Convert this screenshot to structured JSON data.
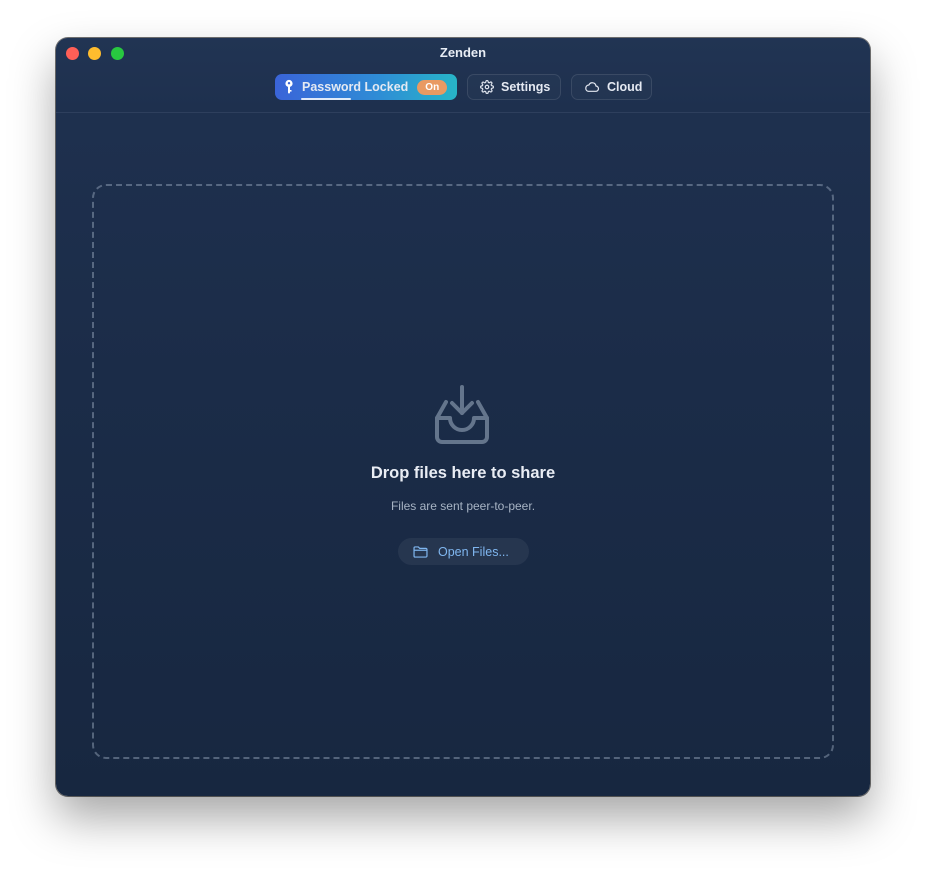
{
  "window": {
    "title": "Zenden"
  },
  "toolbar": {
    "password_label": "Password Locked",
    "password_badge": "On",
    "settings_label": "Settings",
    "cloud_label": "Cloud"
  },
  "dropzone": {
    "title": "Drop files here to share",
    "subtitle": "Files are sent peer-to-peer.",
    "open_button_label": "Open Files..."
  },
  "colors": {
    "window_bg": "#1b2c48",
    "accent_gradient_start": "#3a64d8",
    "accent_gradient_end": "#27b5c8",
    "badge": "#e99a62",
    "link": "#7fb6ef"
  },
  "icons": {
    "password": "key-icon",
    "settings": "gear-icon",
    "cloud": "cloud-icon",
    "dropzone": "inbox-download-icon",
    "open_files": "folder-icon"
  }
}
